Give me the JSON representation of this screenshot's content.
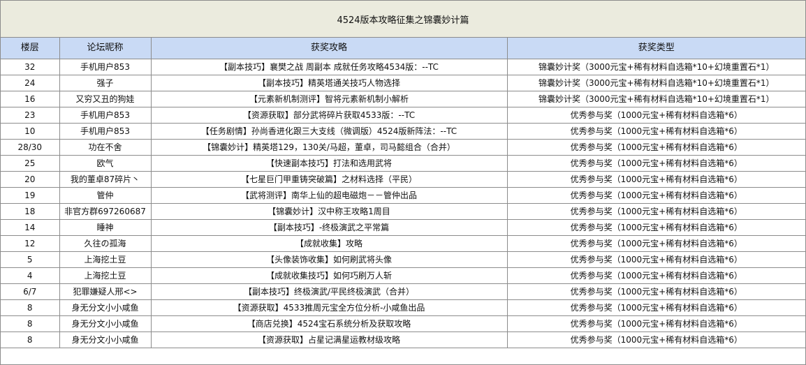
{
  "title": "4524版本攻略征集之锦囊妙计篇",
  "headers": [
    "楼层",
    "论坛昵称",
    "获奖攻略",
    "获奖类型"
  ],
  "rows": [
    {
      "floor": "32",
      "nickname": "手机用户853",
      "guide": "【副本技巧】襄樊之战 周副本 成就任务攻略4534版：--TC",
      "award": "锦囊妙计奖（3000元宝+稀有材料自选箱*10+幻境重置石*1）"
    },
    {
      "floor": "24",
      "nickname": "强子",
      "guide": "【副本技巧】精英塔通关技巧人物选择",
      "award": "锦囊妙计奖（3000元宝+稀有材料自选箱*10+幻境重置石*1）"
    },
    {
      "floor": "16",
      "nickname": "又穷又丑的狗娃",
      "guide": "【元素新机制测评】智将元素新机制小解析",
      "award": "锦囊妙计奖（3000元宝+稀有材料自选箱*10+幻境重置石*1）"
    },
    {
      "floor": "23",
      "nickname": "手机用户853",
      "guide": "【资源获取】部分武将碎片获取4533版：--TC",
      "award": "优秀参与奖（1000元宝+稀有材料自选箱*6）"
    },
    {
      "floor": "10",
      "nickname": "手机用户853",
      "guide": "【任务剧情】孙尚香进化跟三大支线（微调版）4524版新阵法：--TC",
      "award": "优秀参与奖（1000元宝+稀有材料自选箱*6）"
    },
    {
      "floor": "28/30",
      "nickname": "功在不舍",
      "guide": "【锦囊妙计】精英塔129，130关/马超，董卓，司马懿组合（合并）",
      "award": "优秀参与奖（1000元宝+稀有材料自选箱*6）"
    },
    {
      "floor": "25",
      "nickname": "欧气",
      "guide": "【快速副本技巧】打法和选用武将",
      "award": "优秀参与奖（1000元宝+稀有材料自选箱*6）"
    },
    {
      "floor": "20",
      "nickname": "我的董卓87碎片丶",
      "guide": "【七星巨门甲重铸突破篇】之材料选择（平民）",
      "award": "优秀参与奖（1000元宝+稀有材料自选箱*6）"
    },
    {
      "floor": "19",
      "nickname": "管仲",
      "guide": "【武将测评】南华上仙的超电磁炮－－管仲出品",
      "award": "优秀参与奖（1000元宝+稀有材料自选箱*6）"
    },
    {
      "floor": "18",
      "nickname": "非官方群697260687",
      "guide": "【锦囊妙计】汉中称王攻略1周目",
      "award": "优秀参与奖（1000元宝+稀有材料自选箱*6）"
    },
    {
      "floor": "14",
      "nickname": "睡神",
      "guide": "【副本技巧】-终极演武之平常篇",
      "award": "优秀参与奖（1000元宝+稀有材料自选箱*6）"
    },
    {
      "floor": "12",
      "nickname": "久往の孤海",
      "guide": "【成就收集】攻略",
      "award": "优秀参与奖（1000元宝+稀有材料自选箱*6）"
    },
    {
      "floor": "5",
      "nickname": "上海挖土豆",
      "guide": "【头像装饰收集】如何刷武将头像",
      "award": "优秀参与奖（1000元宝+稀有材料自选箱*6）"
    },
    {
      "floor": "4",
      "nickname": "上海挖土豆",
      "guide": "【成就收集技巧】如何巧刷万人斩",
      "award": "优秀参与奖（1000元宝+稀有材料自选箱*6）"
    },
    {
      "floor": "6/7",
      "nickname": "犯罪嫌疑人邢<>",
      "guide": "【副本技巧】终极演武/平民终极演武（合并）",
      "award": "优秀参与奖（1000元宝+稀有材料自选箱*6）"
    },
    {
      "floor": "8",
      "nickname": "身无分文小小咸鱼",
      "guide": "【资源获取】4533推周元宝全方位分析-小咸鱼出品",
      "award": "优秀参与奖（1000元宝+稀有材料自选箱*6）"
    },
    {
      "floor": "8",
      "nickname": "身无分文小小咸鱼",
      "guide": "【商店兑换】4524宝石系统分析及获取攻略",
      "award": "优秀参与奖（1000元宝+稀有材料自选箱*6）"
    },
    {
      "floor": "8",
      "nickname": "身无分文小小咸鱼",
      "guide": "【资源获取】占星记满星运教材级攻略",
      "award": "优秀参与奖（1000元宝+稀有材料自选箱*6）"
    }
  ]
}
